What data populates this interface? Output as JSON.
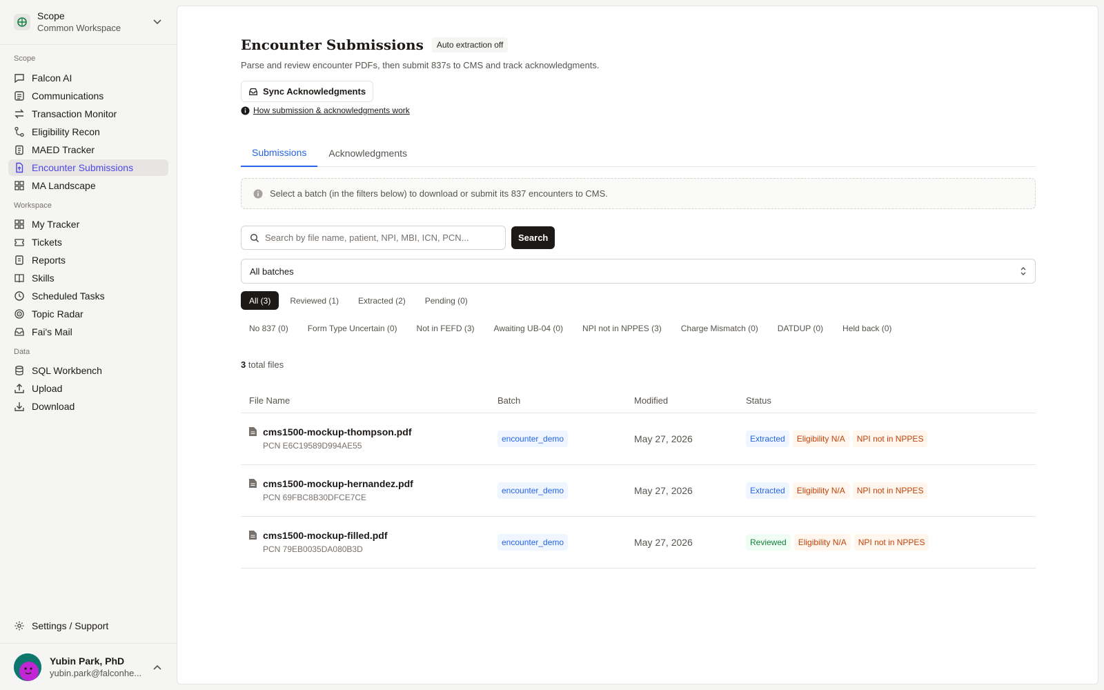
{
  "workspace": {
    "title": "Scope",
    "subtitle": "Common Workspace"
  },
  "nav": {
    "sections": [
      {
        "label": "Scope",
        "items": [
          {
            "label": "Falcon AI",
            "icon": "chat-icon"
          },
          {
            "label": "Communications",
            "icon": "newspaper-icon"
          },
          {
            "label": "Transaction Monitor",
            "icon": "arrows-icon"
          },
          {
            "label": "Eligibility Recon",
            "icon": "git-icon"
          },
          {
            "label": "MAED Tracker",
            "icon": "clipboard-icon"
          },
          {
            "label": "Encounter Submissions",
            "icon": "file-upload-icon",
            "active": true
          },
          {
            "label": "MA Landscape",
            "icon": "grid-icon"
          }
        ]
      },
      {
        "label": "Workspace",
        "items": [
          {
            "label": "My Tracker",
            "icon": "grid-icon"
          },
          {
            "label": "Tickets",
            "icon": "ticket-icon"
          },
          {
            "label": "Reports",
            "icon": "report-icon"
          },
          {
            "label": "Skills",
            "icon": "book-icon"
          },
          {
            "label": "Scheduled Tasks",
            "icon": "clock-icon"
          },
          {
            "label": "Topic Radar",
            "icon": "radar-icon"
          },
          {
            "label": "Fai's Mail",
            "icon": "mail-icon"
          }
        ]
      },
      {
        "label": "Data",
        "items": [
          {
            "label": "SQL Workbench",
            "icon": "database-icon"
          },
          {
            "label": "Upload",
            "icon": "upload-icon"
          },
          {
            "label": "Download",
            "icon": "download-icon"
          }
        ]
      }
    ],
    "settings": "Settings / Support"
  },
  "user": {
    "name": "Yubin Park, PhD",
    "email": "yubin.park@falconhe..."
  },
  "header": {
    "title": "Encounter Submissions",
    "badge": "Auto extraction off",
    "subtitle": "Parse and review encounter PDFs, then submit 837s to CMS and track acknowledgments.",
    "sync_label": "Sync Acknowledgments",
    "howto_link": "How submission & acknowledgments work"
  },
  "tabs": [
    {
      "label": "Submissions",
      "active": true
    },
    {
      "label": "Acknowledgments",
      "active": false
    }
  ],
  "info": "Select a batch (in the filters below) to download or submit its 837 encounters to CMS.",
  "search": {
    "placeholder": "Search by file name, patient, NPI, MBI, ICN, PCN...",
    "value": "",
    "button": "Search"
  },
  "batch_select": {
    "value": "All batches"
  },
  "filters_primary": [
    {
      "label": "All (3)",
      "active": true
    },
    {
      "label": "Reviewed (1)"
    },
    {
      "label": "Extracted (2)"
    },
    {
      "label": "Pending (0)"
    }
  ],
  "filters_secondary": [
    {
      "label": "No 837 (0)"
    },
    {
      "label": "Form Type Uncertain (0)"
    },
    {
      "label": "Not in FEFD (3)"
    },
    {
      "label": "Awaiting UB-04 (0)"
    },
    {
      "label": "NPI not in NPPES (3)"
    },
    {
      "label": "Charge Mismatch (0)"
    },
    {
      "label": "DATDUP (0)"
    },
    {
      "label": "Held back (0)"
    }
  ],
  "total": {
    "count": "3",
    "label": "total files"
  },
  "table": {
    "headers": [
      "File Name",
      "Batch",
      "Modified",
      "Status"
    ],
    "rows": [
      {
        "file": "cms1500-mockup-thompson.pdf",
        "pcn": "PCN E6C19589D994AE55",
        "batch": "encounter_demo",
        "modified": "May 27, 2026",
        "tags": [
          {
            "label": "Extracted",
            "tone": "blue"
          },
          {
            "label": "Eligibility N/A",
            "tone": "orange"
          },
          {
            "label": "NPI not in NPPES",
            "tone": "orange"
          }
        ]
      },
      {
        "file": "cms1500-mockup-hernandez.pdf",
        "pcn": "PCN 69FBC8B30DFCE7CE",
        "batch": "encounter_demo",
        "modified": "May 27, 2026",
        "tags": [
          {
            "label": "Extracted",
            "tone": "blue"
          },
          {
            "label": "Eligibility N/A",
            "tone": "orange"
          },
          {
            "label": "NPI not in NPPES",
            "tone": "orange"
          }
        ]
      },
      {
        "file": "cms1500-mockup-filled.pdf",
        "pcn": "PCN 79EB0035DA080B3D",
        "batch": "encounter_demo",
        "modified": "May 27, 2026",
        "tags": [
          {
            "label": "Reviewed",
            "tone": "green"
          },
          {
            "label": "Eligibility N/A",
            "tone": "orange"
          },
          {
            "label": "NPI not in NPPES",
            "tone": "orange"
          }
        ]
      }
    ]
  },
  "colors": {
    "accent": "#2563eb",
    "nav_active": "#4f46e5",
    "dark": "#1c1917",
    "warn": "#c2410c",
    "ok": "#15803d"
  }
}
